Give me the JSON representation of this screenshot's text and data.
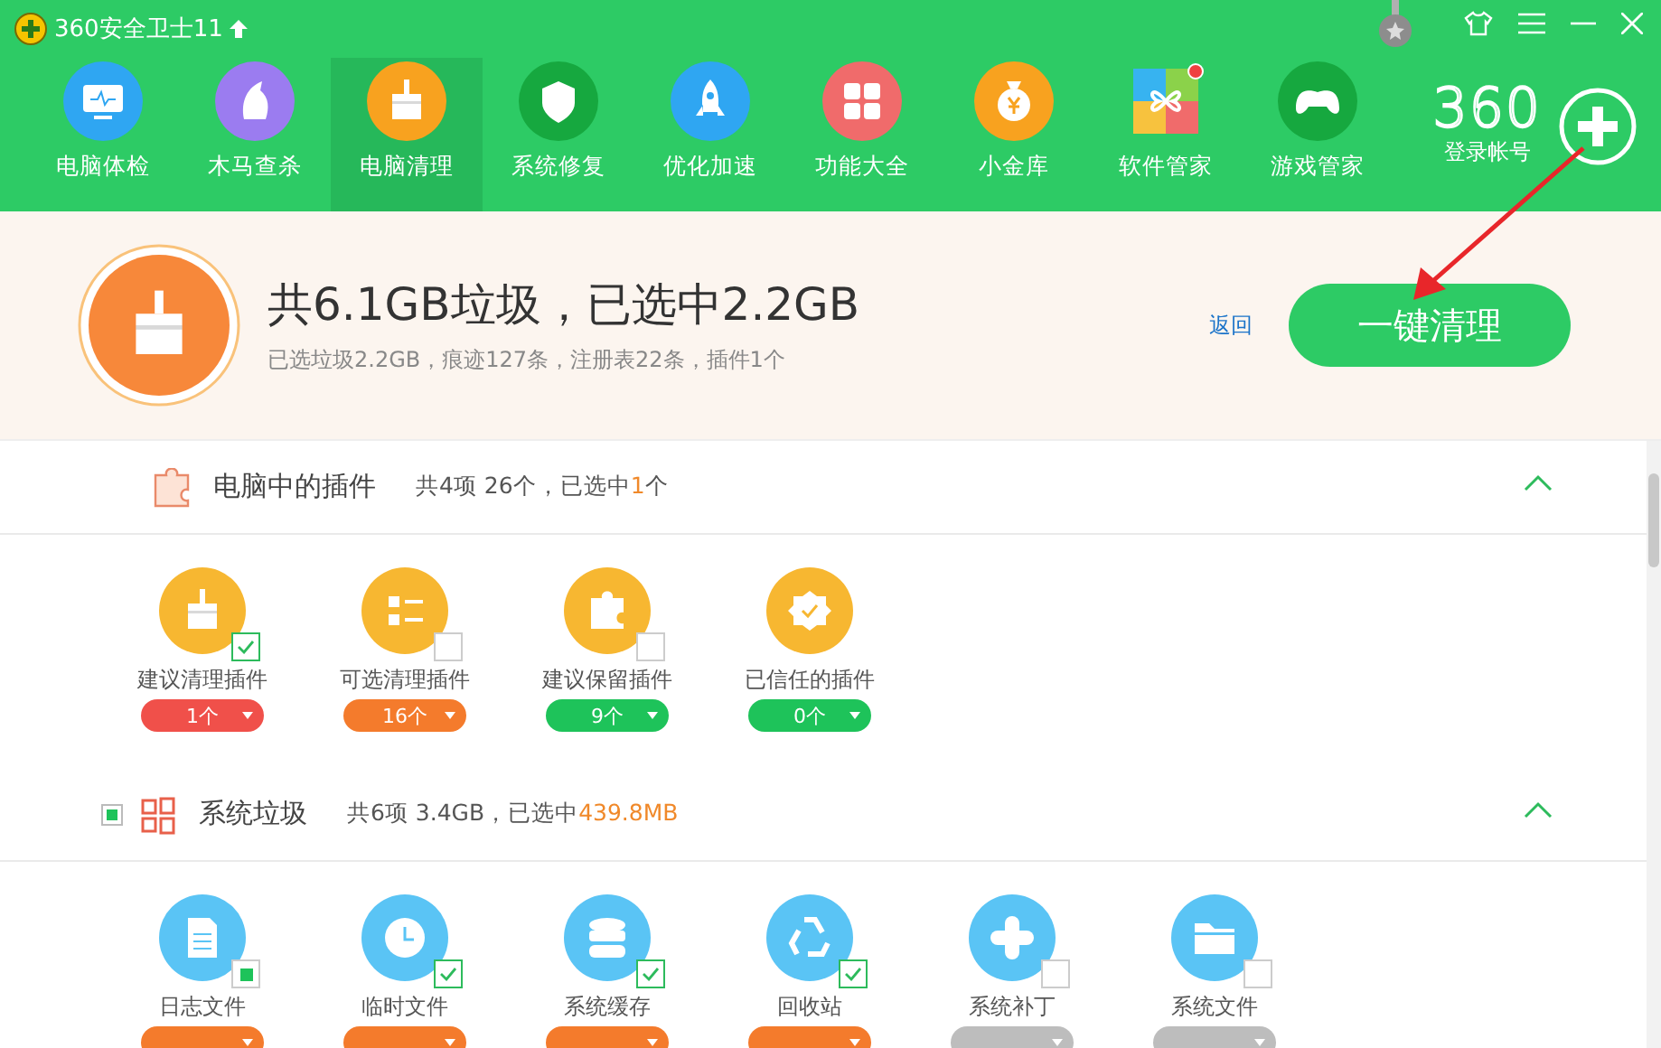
{
  "window": {
    "title": "360安全卫士11"
  },
  "nav": [
    {
      "label": "电脑体检",
      "selected": false
    },
    {
      "label": "木马查杀",
      "selected": false
    },
    {
      "label": "电脑清理",
      "selected": true
    },
    {
      "label": "系统修复",
      "selected": false
    },
    {
      "label": "优化加速",
      "selected": false
    },
    {
      "label": "功能大全",
      "selected": false
    },
    {
      "label": "小金库",
      "selected": false
    },
    {
      "label": "软件管家",
      "selected": false,
      "badge": true
    },
    {
      "label": "游戏管家",
      "selected": false
    }
  ],
  "account": {
    "logo": "360",
    "label": "登录帐号"
  },
  "summary": {
    "headline": "共6.1GB垃圾，已选中2.2GB",
    "detail": "已选垃圾2.2GB，痕迹127条，注册表22条，插件1个",
    "back_link": "返回",
    "clean_button": "一键清理"
  },
  "sections": [
    {
      "title": "电脑中的插件",
      "summary_prefix": "共4项 26个，已选中",
      "selected_amount": "1",
      "summary_suffix": "个",
      "expanded": true,
      "items": [
        {
          "label": "建议清理插件",
          "checked": true,
          "count": "1个",
          "color": "#f0504a"
        },
        {
          "label": "可选清理插件",
          "checked": false,
          "count": "16个",
          "color": "#f47b2c"
        },
        {
          "label": "建议保留插件",
          "checked": false,
          "count": "9个",
          "color": "#1ec35a"
        },
        {
          "label": "已信任的插件",
          "count": "0个",
          "color": "#1ec35a"
        }
      ]
    },
    {
      "title": "系统垃圾",
      "indeterminate": true,
      "summary_prefix": "共6项 3.4GB，已选中",
      "selected_amount": "439.8MB",
      "expanded": true,
      "items": [
        {
          "label": "日志文件",
          "indeterminate": true,
          "color": "#f47b2c"
        },
        {
          "label": "临时文件",
          "checked": true,
          "color": "#f47b2c"
        },
        {
          "label": "系统缓存",
          "checked": true,
          "color": "#f47b2c"
        },
        {
          "label": "回收站",
          "checked": true,
          "color": "#f47b2c"
        },
        {
          "label": "系统补丁",
          "checked": false,
          "color": "#bdbdbd"
        },
        {
          "label": "系统文件",
          "checked": false,
          "color": "#bdbdbd"
        }
      ]
    }
  ]
}
